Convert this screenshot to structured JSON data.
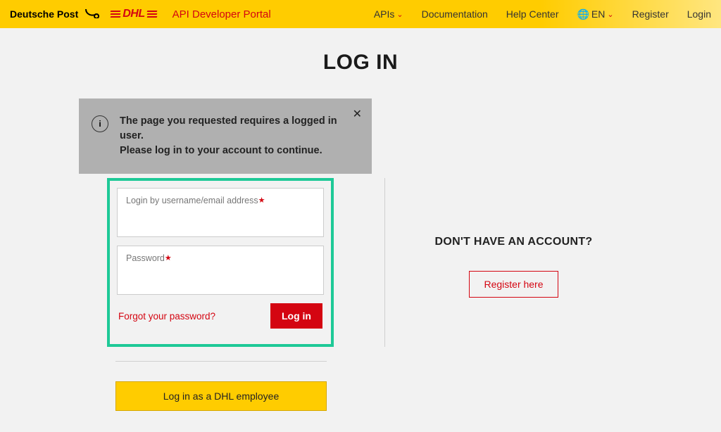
{
  "header": {
    "brand_dp": "Deutsche Post",
    "brand_dhl": "DHL",
    "portal_title": "API Developer Portal",
    "nav": {
      "apis": "APIs",
      "documentation": "Documentation",
      "help_center": "Help Center",
      "lang": "EN",
      "register": "Register",
      "login": "Login"
    }
  },
  "page": {
    "title": "LOG IN"
  },
  "notice": {
    "line1": "The page you requested requires a logged in user.",
    "line2": "Please log in to your account to continue."
  },
  "login_form": {
    "username_label": "Login by username/email address",
    "password_label": "Password",
    "forgot": "Forgot your password?",
    "login_btn": "Log in"
  },
  "register_panel": {
    "heading": "DON'T HAVE AN ACCOUNT?",
    "button": "Register here"
  },
  "employee": {
    "button": "Log in as a DHL employee"
  }
}
